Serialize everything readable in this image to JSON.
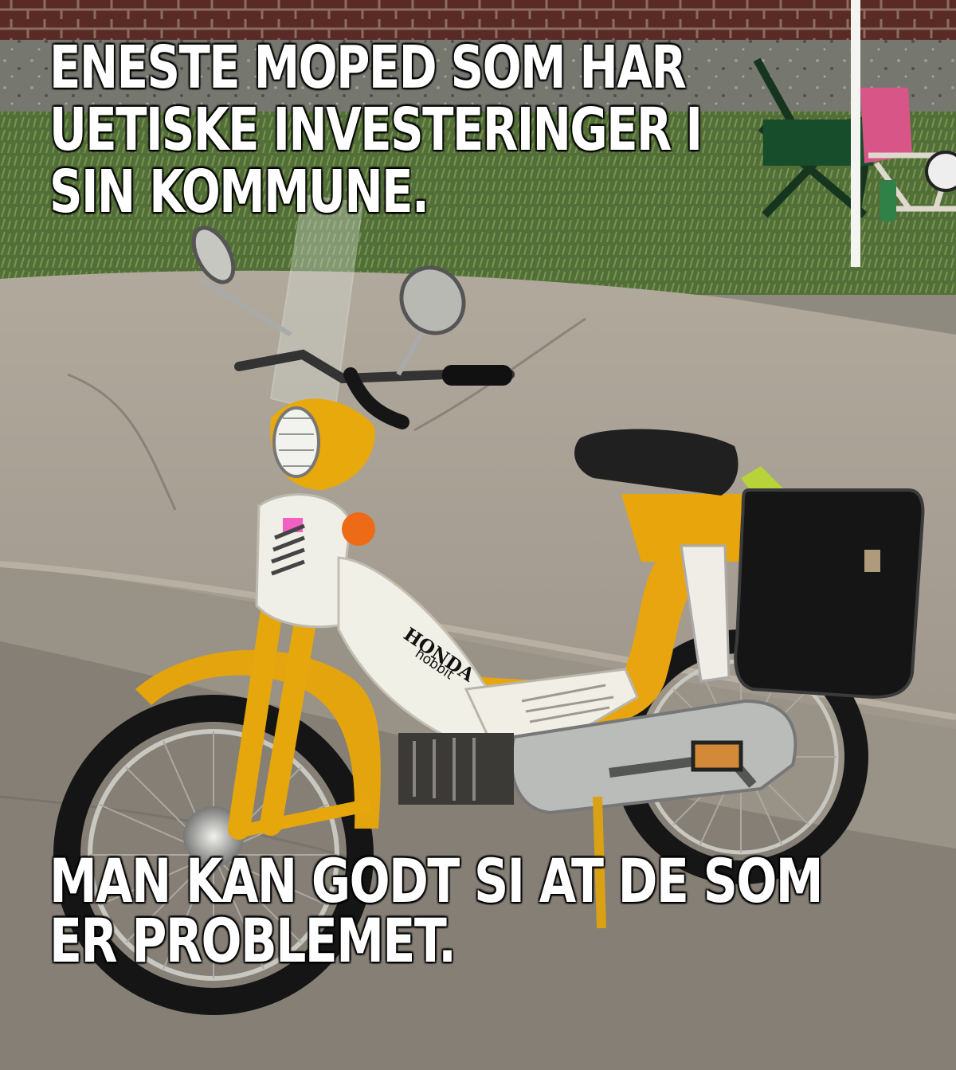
{
  "meme": {
    "top_text": "ENESTE MOPED SOM HAR\nUETISKE INVESTERINGER I\nSIN KOMMUNE.",
    "bottom_text": "MAN KAN GODT SI AT DE SOM\nER PROBLEMET."
  },
  "photo": {
    "subject": "yellow-white-moped",
    "brand_logo": "HONDA",
    "model_logo": "hobbit",
    "colors": {
      "body": "#e8a70b",
      "panel": "#efeee3",
      "seat": "#202020",
      "pavement": "#a8a196",
      "grass": "#55703b",
      "wall": "#5b3028"
    }
  }
}
